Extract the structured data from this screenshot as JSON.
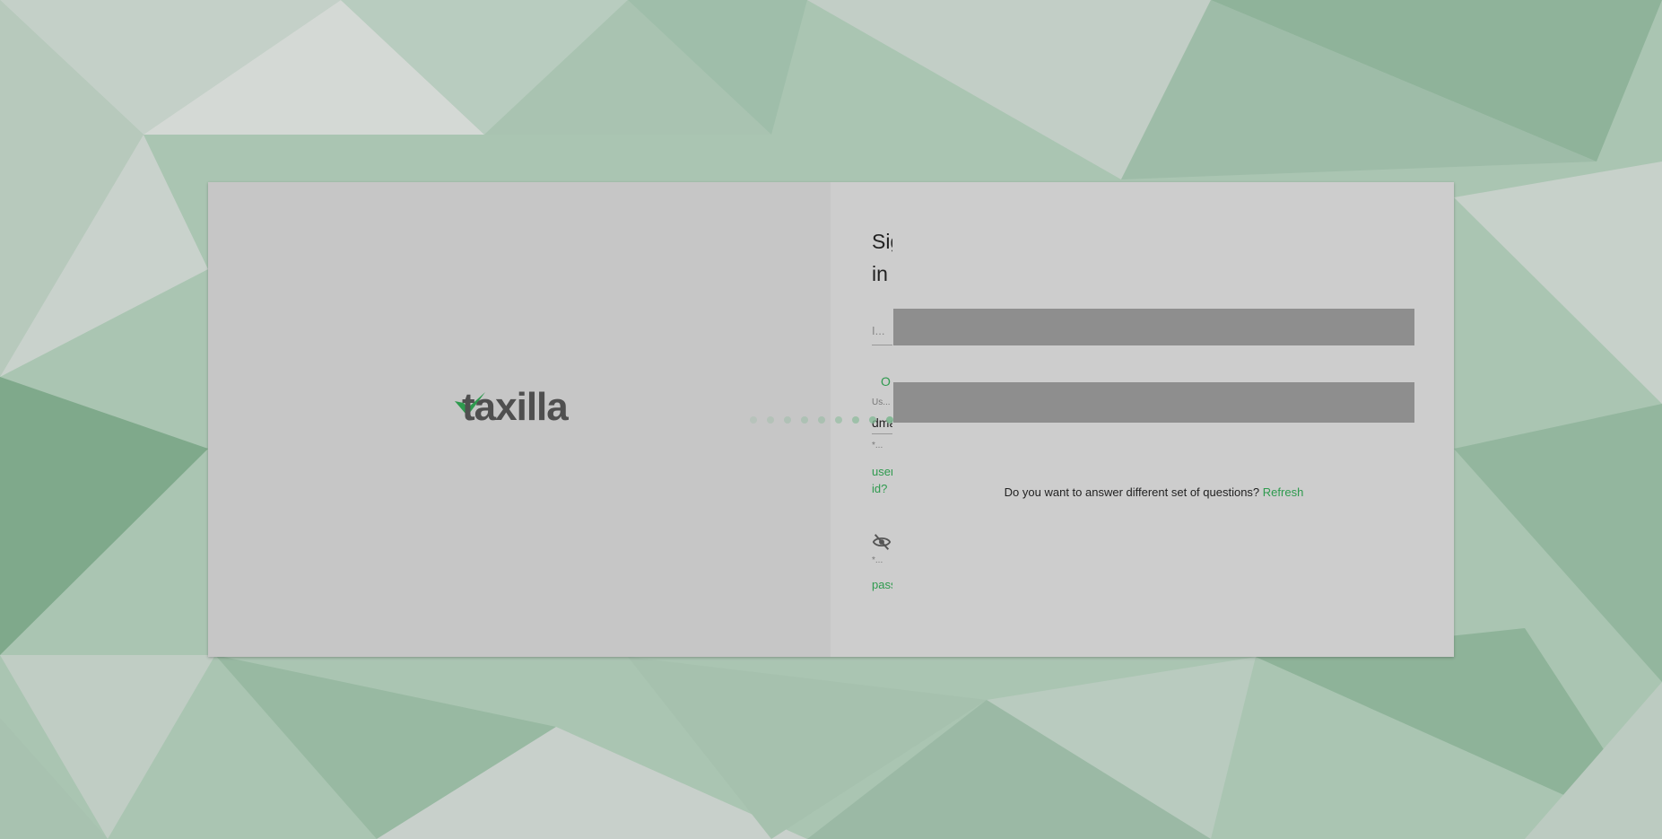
{
  "brand": {
    "name": "taxilla",
    "accent_color": "#2e9a4e",
    "logo_icon": "checkmark-icon"
  },
  "signin": {
    "title": "Sig in",
    "id_field_text": "I...",
    "or_text": "O",
    "username_label": "Us...",
    "username_value": "dma",
    "required_note_1": "*...",
    "forgot_username": "user id?",
    "password_icon": "eye-off-icon",
    "required_note_2": "*...",
    "forgot_password": "pass"
  },
  "captcha": {
    "question_text": "Do you want to answer different set of questions?",
    "refresh_label": "Refresh"
  },
  "loader": {
    "icon": "loading-dots-icon"
  }
}
